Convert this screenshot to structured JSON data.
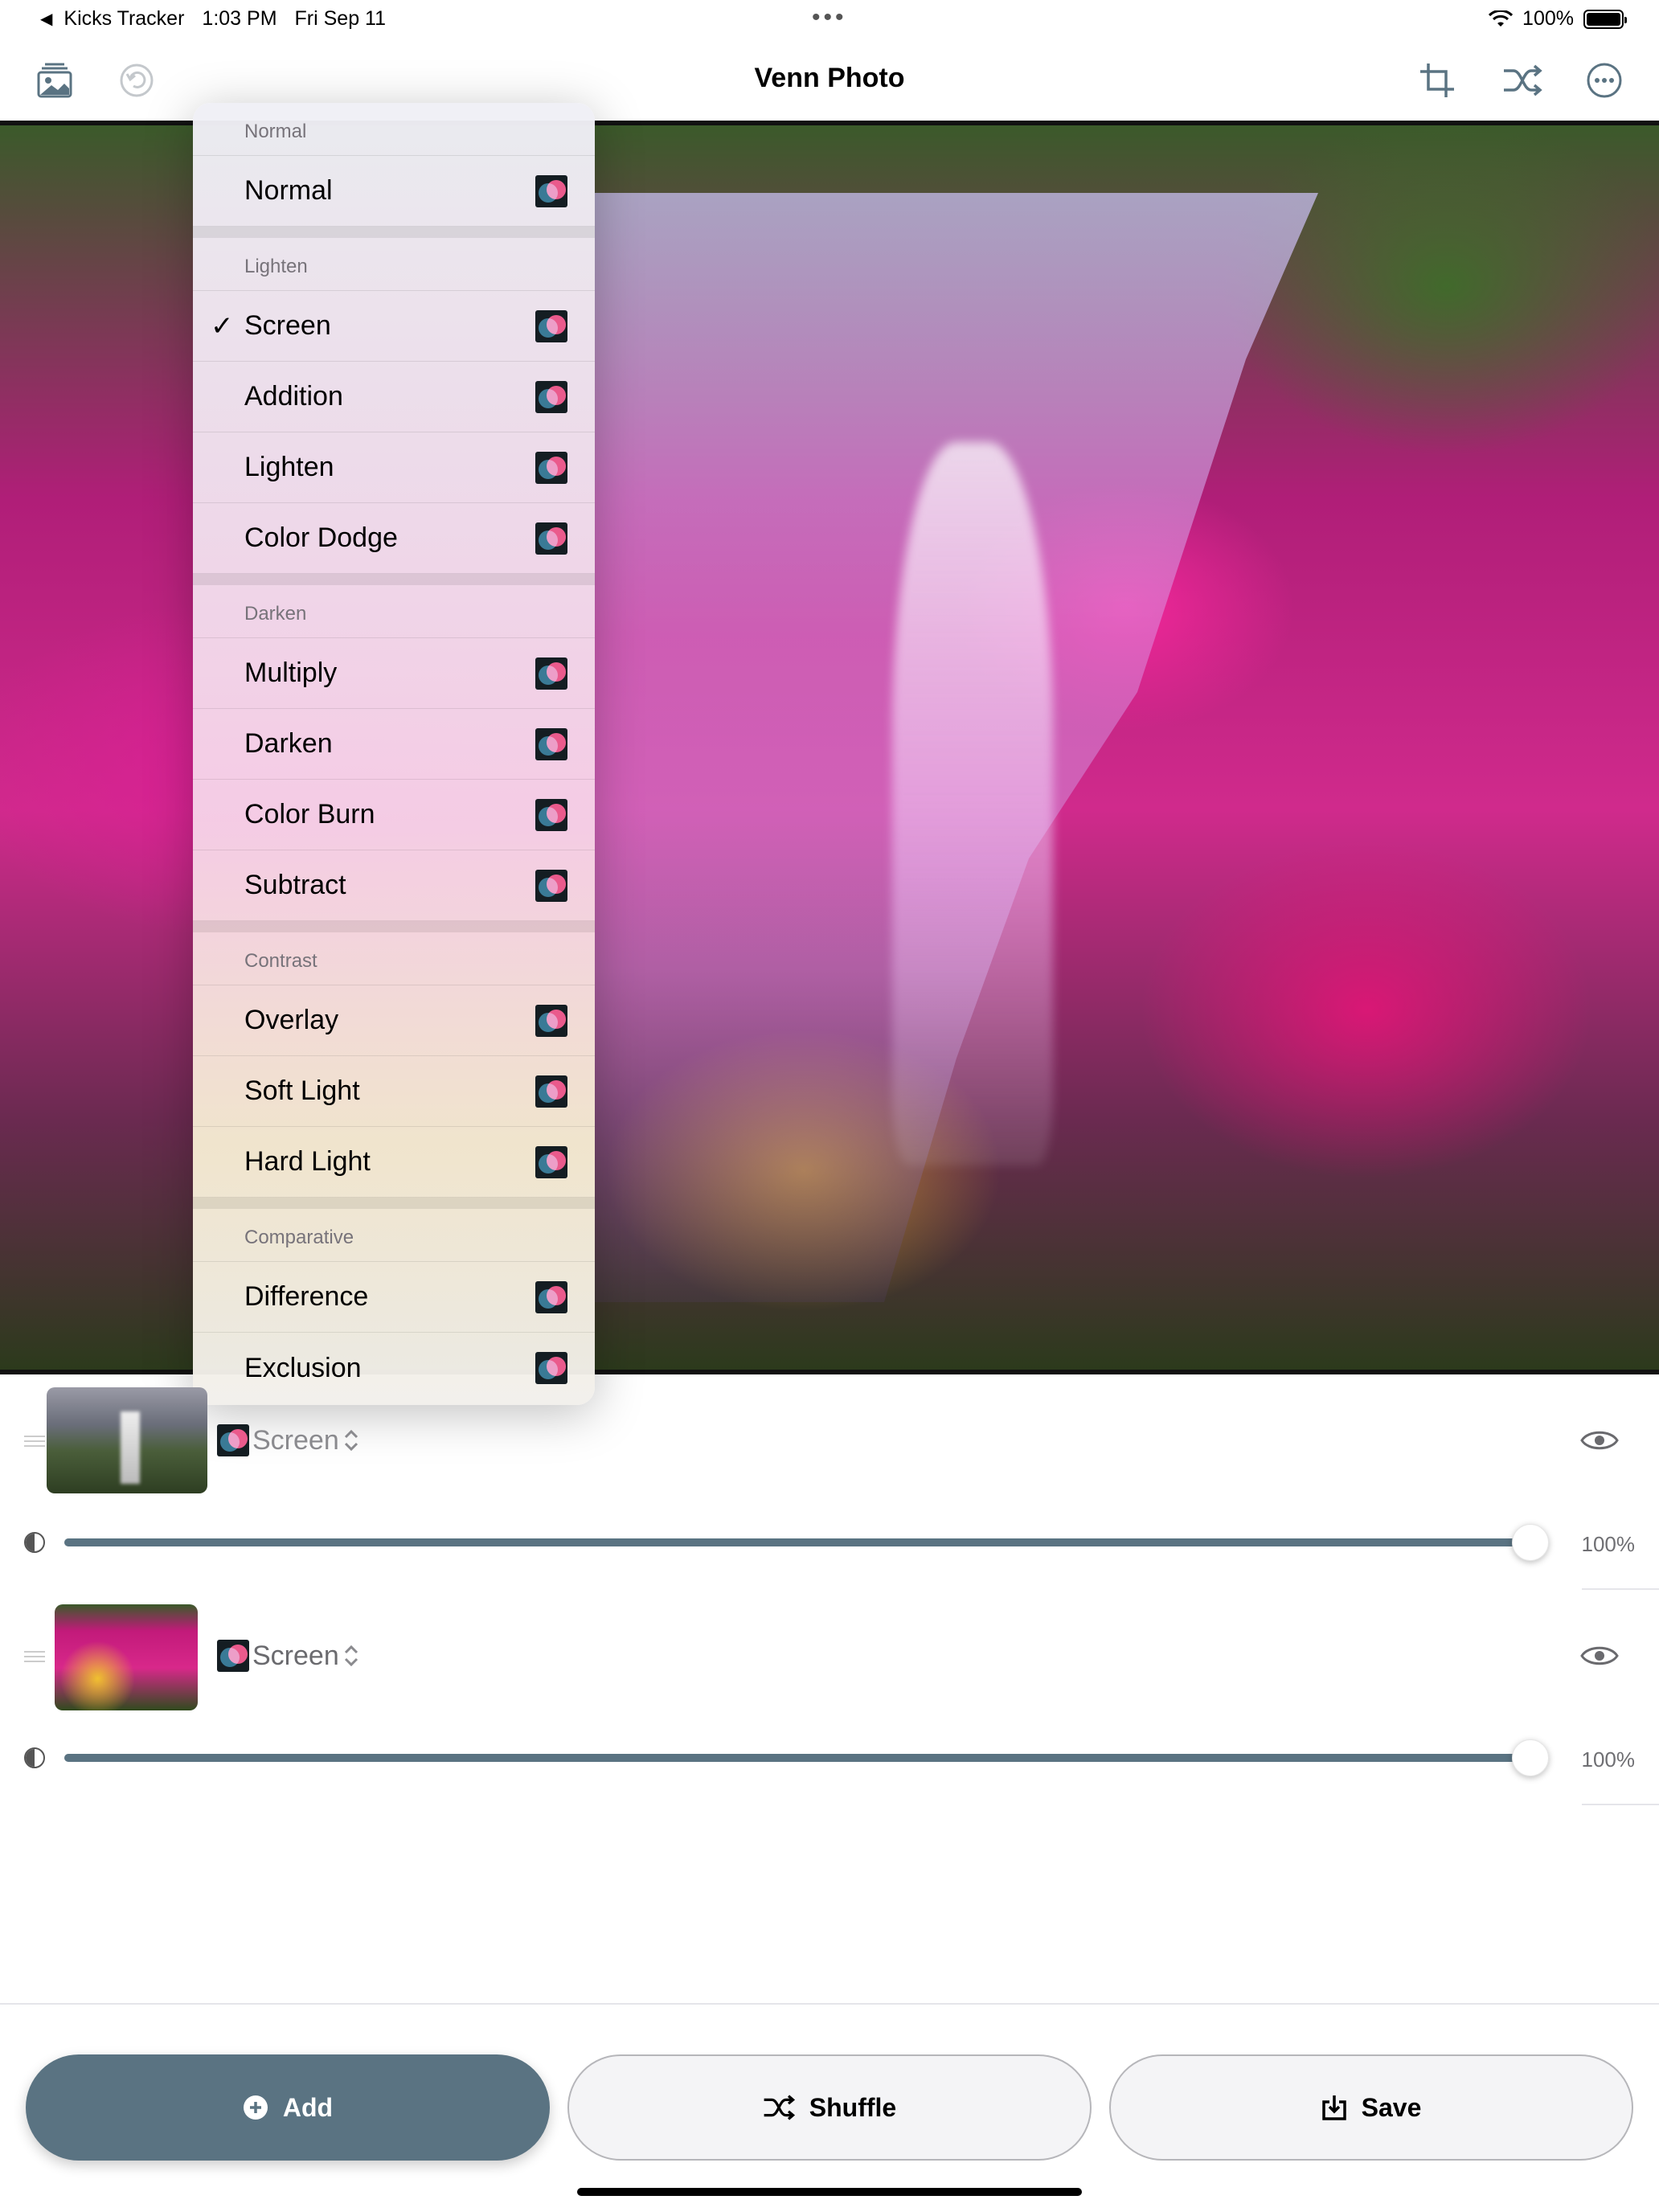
{
  "status_bar": {
    "back_app": "Kicks Tracker",
    "time": "1:03 PM",
    "date": "Fri Sep 11",
    "battery": "100%"
  },
  "toolbar": {
    "title": "Venn Photo"
  },
  "blend_menu": {
    "sections": [
      {
        "header": "Normal",
        "items": [
          {
            "label": "Normal",
            "checked": false
          }
        ]
      },
      {
        "header": "Lighten",
        "items": [
          {
            "label": "Screen",
            "checked": true
          },
          {
            "label": "Addition",
            "checked": false
          },
          {
            "label": "Lighten",
            "checked": false
          },
          {
            "label": "Color Dodge",
            "checked": false
          }
        ]
      },
      {
        "header": "Darken",
        "items": [
          {
            "label": "Multiply",
            "checked": false
          },
          {
            "label": "Darken",
            "checked": false
          },
          {
            "label": "Color Burn",
            "checked": false
          },
          {
            "label": "Subtract",
            "checked": false
          }
        ]
      },
      {
        "header": "Contrast",
        "items": [
          {
            "label": "Overlay",
            "checked": false
          },
          {
            "label": "Soft Light",
            "checked": false
          },
          {
            "label": "Hard Light",
            "checked": false
          }
        ]
      },
      {
        "header": "Comparative",
        "items": [
          {
            "label": "Difference",
            "checked": false
          },
          {
            "label": "Exclusion",
            "checked": false
          }
        ]
      }
    ],
    "check_glyph": "✓"
  },
  "layers": [
    {
      "blend_mode": "Screen",
      "opacity": 100,
      "opacity_label": "100%"
    },
    {
      "blend_mode": "Screen",
      "opacity": 100,
      "opacity_label": "100%"
    }
  ],
  "buttons": {
    "add": "Add",
    "shuffle": "Shuffle",
    "save": "Save"
  },
  "colors": {
    "accent": "#5a7382",
    "button_border": "#b6b6ba"
  }
}
